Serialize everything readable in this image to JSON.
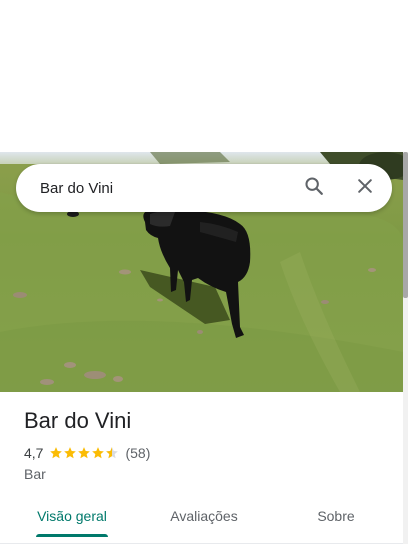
{
  "search": {
    "value": "Bar do Vini",
    "search_icon": "search-icon",
    "close_icon": "close-icon"
  },
  "place": {
    "name": "Bar do Vini",
    "rating": "4,7",
    "stars": 4.7,
    "review_count": "(58)",
    "category": "Bar"
  },
  "tabs": [
    {
      "label": "Visão geral",
      "active": true
    },
    {
      "label": "Avaliações",
      "active": false
    },
    {
      "label": "Sobre",
      "active": false
    }
  ],
  "colors": {
    "accent": "#00796b",
    "star": "#fbbc04",
    "text": "#202124",
    "muted": "#5f6368"
  }
}
